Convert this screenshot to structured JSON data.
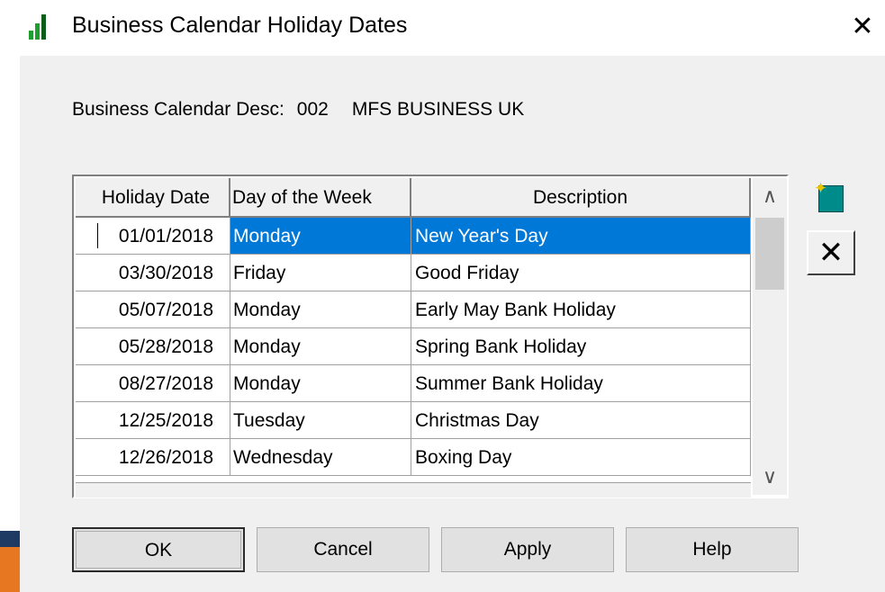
{
  "window": {
    "title": "Business Calendar Holiday Dates",
    "close_glyph": "✕",
    "icon": "bar-chart-icon",
    "colors": {
      "icon_green": "#1e9e2e",
      "icon_dark": "#0b5e1a"
    }
  },
  "description": {
    "label": "Business Calendar Desc:",
    "code": "002",
    "name": "MFS BUSINESS UK"
  },
  "table": {
    "columns": [
      "Holiday Date",
      "Day of the Week",
      "Description"
    ],
    "rows": [
      {
        "date": "01/01/2018",
        "day": "Monday",
        "description": "New Year's Day",
        "selected": true
      },
      {
        "date": "03/30/2018",
        "day": "Friday",
        "description": "Good Friday",
        "selected": false
      },
      {
        "date": "05/07/2018",
        "day": "Monday",
        "description": "Early May Bank Holiday",
        "selected": false
      },
      {
        "date": "05/28/2018",
        "day": "Monday",
        "description": "Spring Bank Holiday",
        "selected": false
      },
      {
        "date": "08/27/2018",
        "day": "Monday",
        "description": "Summer Bank Holiday",
        "selected": false
      },
      {
        "date": "12/25/2018",
        "day": "Tuesday",
        "description": "Christmas Day",
        "selected": false
      },
      {
        "date": "12/26/2018",
        "day": "Wednesday",
        "description": "Boxing Day",
        "selected": false
      }
    ],
    "selection_color": "#0078d7"
  },
  "scrollbar": {
    "up_glyph": "∧",
    "down_glyph": "∨"
  },
  "tools": {
    "add_icon": "add-row-icon",
    "delete_icon": "delete-row-icon",
    "delete_glyph": "✕"
  },
  "buttons": {
    "ok": "OK",
    "cancel": "Cancel",
    "apply": "Apply",
    "help": "Help"
  }
}
